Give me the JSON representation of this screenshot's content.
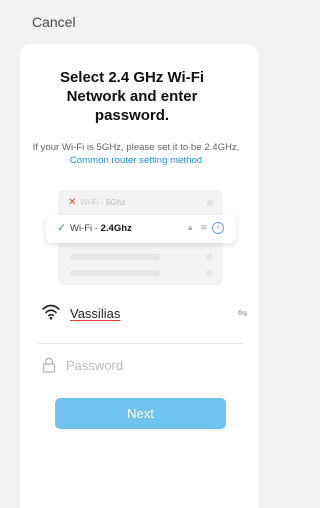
{
  "header": {
    "cancel_label": "Cancel"
  },
  "main": {
    "title": "Select 2.4 GHz Wi-Fi Network and enter password.",
    "subtitle_text": "If your Wi-Fi is 5GHz, please set it to be 2.4GHz.",
    "subtitle_link": "Common router setting method"
  },
  "illustration": {
    "faded_prefix": "Wi-Fi - ",
    "faded_band": "5Ghz",
    "selected_prefix": "Wi-Fi - ",
    "selected_band": "2.4Ghz"
  },
  "form": {
    "ssid": "Vassilias",
    "password_placeholder": "Password",
    "password_value": ""
  },
  "actions": {
    "next_label": "Next"
  },
  "colors": {
    "accent": "#6fc4ee",
    "link": "#1e90d6",
    "error_mark": "#e74c3c",
    "check": "#30b85c"
  }
}
